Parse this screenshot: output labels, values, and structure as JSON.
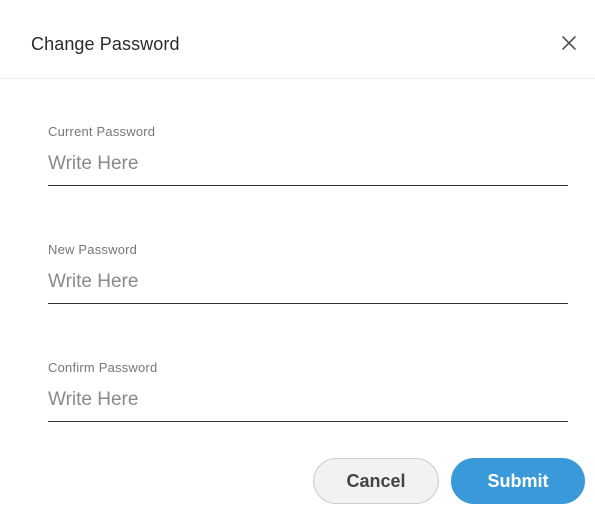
{
  "dialog": {
    "title": "Change Password",
    "close_icon": "close-icon"
  },
  "form": {
    "fields": [
      {
        "label": "Current Password",
        "placeholder": "Write Here",
        "value": ""
      },
      {
        "label": "New Password",
        "placeholder": "Write Here",
        "value": ""
      },
      {
        "label": "Confirm Password",
        "placeholder": "Write Here",
        "value": ""
      }
    ]
  },
  "actions": {
    "cancel_label": "Cancel",
    "submit_label": "Submit"
  },
  "colors": {
    "accent": "#3a9ad9",
    "cancel_bg": "#f2f2f2",
    "text": "#333333"
  }
}
